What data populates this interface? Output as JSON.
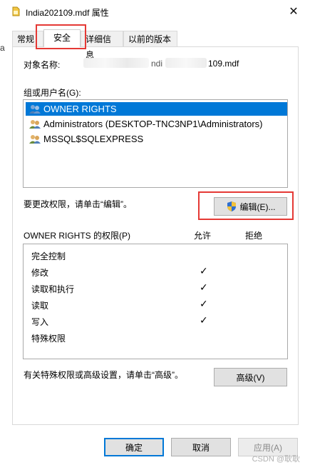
{
  "window": {
    "title": "India202109.mdf 属性",
    "close_label": "✕"
  },
  "left_artifact": "a",
  "tabs": [
    {
      "label": "常规"
    },
    {
      "label": "安全"
    },
    {
      "label": "详细信息"
    },
    {
      "label": "以前的版本"
    }
  ],
  "object_name": {
    "label": "对象名称:",
    "value_visible_1": "ndi",
    "value_visible_2": "109.mdf"
  },
  "groups": {
    "label": "组或用户名(G):",
    "items": [
      "OWNER RIGHTS",
      "Administrators (DESKTOP-TNC3NP1\\Administrators)",
      "MSSQL$SQLEXPRESS"
    ]
  },
  "change_prompt": "要更改权限，请单击“编辑”。",
  "edit_button": "编辑(E)...",
  "permissions": {
    "title": "OWNER RIGHTS 的权限(P)",
    "allow_header": "允许",
    "deny_header": "拒绝",
    "rows": [
      {
        "name": "完全控制",
        "allow": ""
      },
      {
        "name": "修改",
        "allow": "✓"
      },
      {
        "name": "读取和执行",
        "allow": "✓"
      },
      {
        "name": "读取",
        "allow": "✓"
      },
      {
        "name": "写入",
        "allow": "✓"
      },
      {
        "name": "特殊权限",
        "allow": ""
      }
    ]
  },
  "advanced_prompt": "有关特殊权限或高级设置，请单击“高级”。",
  "advanced_button": "高级(V)",
  "footer": {
    "ok": "确定",
    "cancel": "取消",
    "apply": "应用(A)"
  },
  "watermark": "CSDN @耿耿"
}
